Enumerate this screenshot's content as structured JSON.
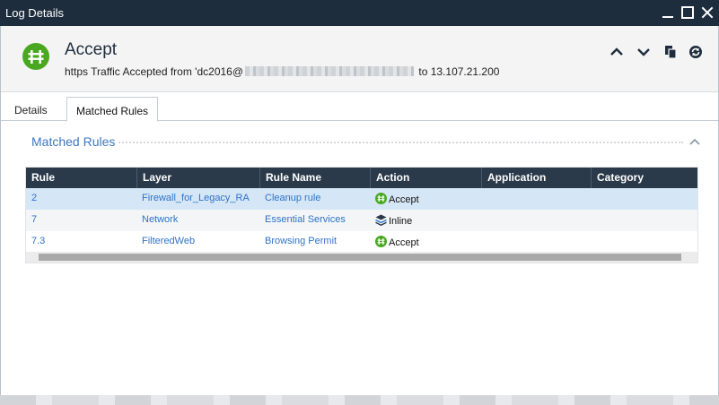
{
  "window": {
    "title": "Log Details",
    "controls": {
      "minimize": "minimize-icon",
      "maximize": "maximize-icon",
      "close": "close-icon"
    }
  },
  "header": {
    "action": "Accept",
    "status_icon": "accept-icon",
    "status_color": "#4aa820",
    "summary_prefix": "https Traffic Accepted from  'dc2016@",
    "summary_suffix": " to 13.107.21.200",
    "buttons": {
      "up": "chevron-up-icon",
      "down": "chevron-down-icon",
      "copy": "copy-icon",
      "refresh": "refresh-icon"
    }
  },
  "tabs": [
    {
      "label": "Details",
      "active": false
    },
    {
      "label": "Matched Rules",
      "active": true
    }
  ],
  "section": {
    "title": "Matched Rules",
    "collapse_icon": "chevron-up-icon"
  },
  "grid": {
    "columns": [
      "Rule",
      "Layer",
      "Rule Name",
      "Action",
      "Application",
      "Category"
    ],
    "rows": [
      {
        "rule": "2",
        "layer": "Firewall_for_Legacy_RA",
        "rule_name": "Cleanup rule",
        "action": "Accept",
        "action_icon": "accept-icon",
        "application": "",
        "category": "",
        "selected": true
      },
      {
        "rule": "7",
        "layer": "Network",
        "rule_name": "Essential Services",
        "action": "Inline",
        "action_icon": "layers-icon",
        "application": "",
        "category": "",
        "selected": false
      },
      {
        "rule": "7.3",
        "layer": "FilteredWeb",
        "rule_name": "Browsing Permit",
        "action": "Accept",
        "action_icon": "accept-icon",
        "application": "",
        "category": "",
        "selected": false
      }
    ]
  },
  "colors": {
    "title_bar": "#1e2d3d",
    "grid_header": "#2b3a4b",
    "link": "#2f73c6",
    "selected_row": "#d5e6f6",
    "alt_row": "#f3f5f7"
  }
}
